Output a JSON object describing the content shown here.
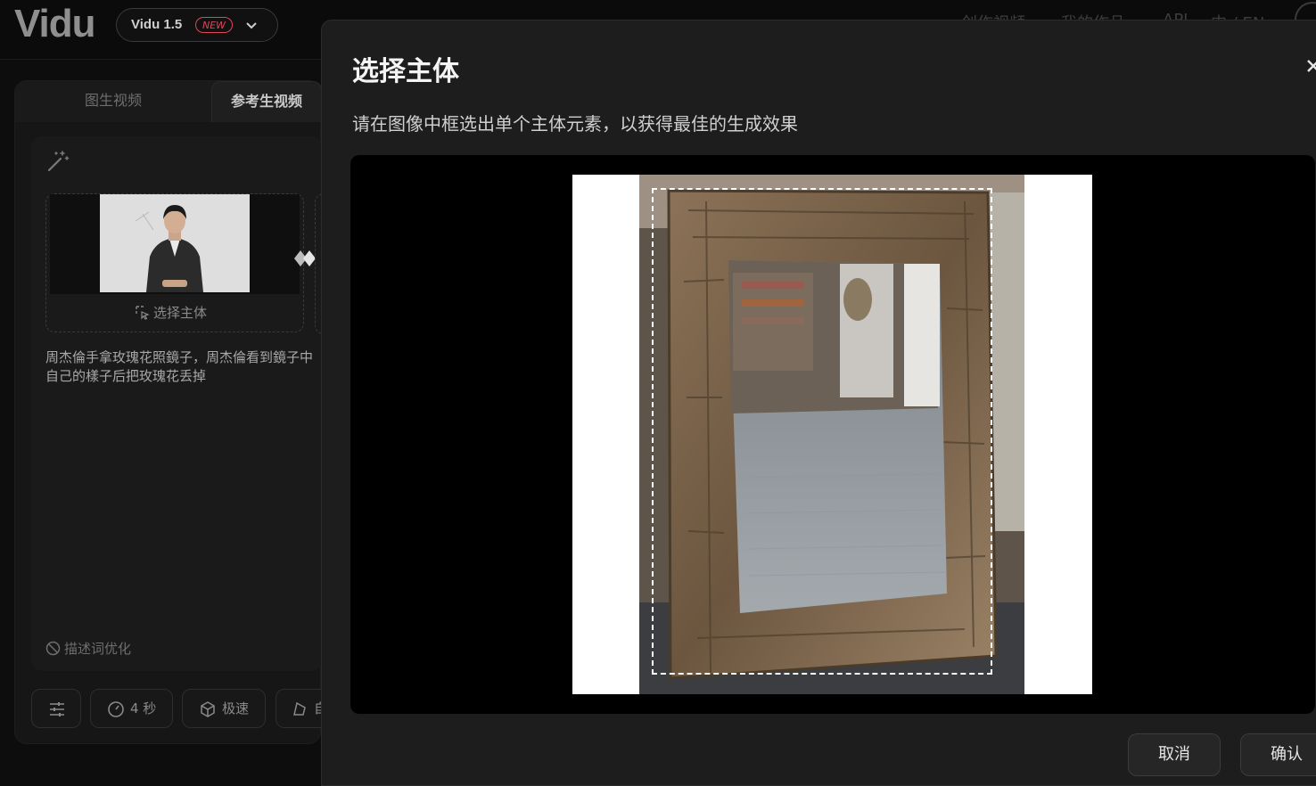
{
  "header": {
    "logo": "Vidu",
    "model": {
      "name": "Vidu 1.5",
      "badge": "NEW"
    },
    "nav": [
      "创作视频",
      "我的作品",
      "API",
      "中 / EN"
    ]
  },
  "panel": {
    "tabs": [
      "图生视频",
      "参考生视频"
    ],
    "upload": {
      "select_subject_label": "选择主体"
    },
    "prompt": "周杰倫手拿玫瑰花照鏡子，周杰倫看到鏡子中自己的樣子后把玫瑰花丢掉",
    "optimize_label": "描述词优化",
    "chips": {
      "duration": "4 秒",
      "speed": "极速",
      "aspect": "自"
    }
  },
  "modal": {
    "title": "选择主体",
    "description": "请在图像中框选出单个主体元素，以获得最佳的生成效果",
    "cancel_label": "取消",
    "confirm_label": "确认"
  },
  "colors": {
    "background": "#0d0d0d",
    "panel": "#161616",
    "modal": "#1d1d1d",
    "new_badge": "#e0455a",
    "crop_border": "#ffffff"
  },
  "icons": [
    "chevron-down-icon",
    "magic-wand-icon",
    "select-region-icon",
    "diamond-icon",
    "ban-icon",
    "sliders-icon",
    "clock-icon",
    "cube-icon",
    "aspect-icon",
    "close-icon"
  ]
}
